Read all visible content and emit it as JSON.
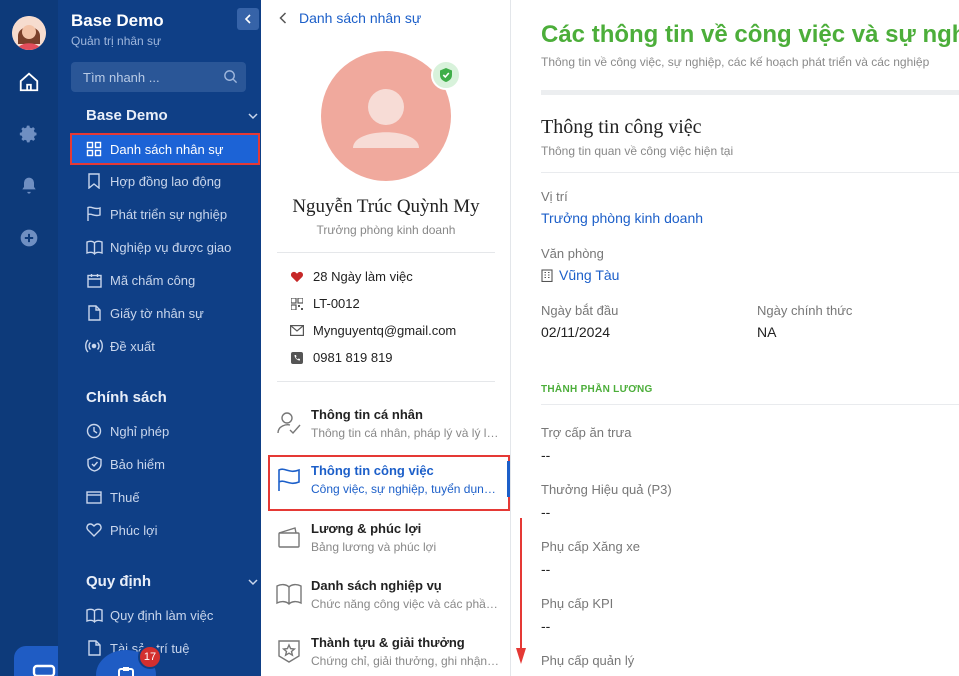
{
  "app": {
    "title": "Base Demo",
    "subtitle": "Quản trị nhân sự",
    "search_placeholder": "Tìm nhanh ...",
    "badge_count": "17"
  },
  "rail": {
    "icons": [
      "home-icon",
      "gear-icon",
      "bell-icon",
      "plus-circle-icon"
    ]
  },
  "sidebar": {
    "sections": [
      {
        "title": "Base Demo",
        "items": [
          {
            "label": "Danh sách nhân sự",
            "icon": "grid-icon",
            "active": true
          },
          {
            "label": "Hợp đồng lao động",
            "icon": "bookmark-icon"
          },
          {
            "label": "Phát triển sự nghiệp",
            "icon": "flag-icon"
          },
          {
            "label": "Nghiệp vụ được giao",
            "icon": "book-icon"
          },
          {
            "label": "Mã chấm công",
            "icon": "calendar-icon"
          },
          {
            "label": "Giấy tờ nhân sự",
            "icon": "document-icon"
          },
          {
            "label": "Đề xuất",
            "icon": "broadcast-icon"
          }
        ]
      },
      {
        "title": "Chính sách",
        "items": [
          {
            "label": "Nghỉ phép",
            "icon": "clock-icon"
          },
          {
            "label": "Bảo hiểm",
            "icon": "shield-icon"
          },
          {
            "label": "Thuế",
            "icon": "card-icon"
          },
          {
            "label": "Phúc lợi",
            "icon": "heart-icon"
          }
        ]
      },
      {
        "title": "Quy định",
        "items": [
          {
            "label": "Quy định làm việc",
            "icon": "book-icon"
          },
          {
            "label": "Tài sản trí tuệ",
            "icon": "document-icon"
          }
        ]
      }
    ]
  },
  "profile": {
    "back_label": "Danh sách nhân sự",
    "name": "Nguyễn Trúc Quỳnh My",
    "role": "Trưởng phòng kinh doanh",
    "details": [
      {
        "icon": "heart-icon",
        "text": "28 Ngày làm việc"
      },
      {
        "icon": "qr-icon",
        "text": "LT-0012"
      },
      {
        "icon": "mail-icon",
        "text": "Mynguyentq@gmail.com"
      },
      {
        "icon": "phone-icon",
        "text": "0981 819 819"
      }
    ],
    "menu": [
      {
        "title": "Thông tin cá nhân",
        "desc": "Thông tin cá nhân, pháp lý và lý lịch",
        "icon": "user-check-icon"
      },
      {
        "title": "Thông tin công việc",
        "desc": "Công việc, sự nghiệp, tuyển dụng ...",
        "icon": "flag-icon",
        "active": true
      },
      {
        "title": "Lương & phúc lợi",
        "desc": "Bảng lương và phúc lợi",
        "icon": "wallet-icon"
      },
      {
        "title": "Danh sách nghiệp vụ",
        "desc": "Chức năng công việc và các phần...",
        "icon": "book-icon"
      },
      {
        "title": "Thành tựu & giải thưởng",
        "desc": "Chứng chỉ, giải thưởng, ghi nhận v...",
        "icon": "star-badge-icon"
      }
    ]
  },
  "main": {
    "title": "Các thông tin về công việc và sự nghiệp",
    "subtitle": "Thông tin về công việc, sự nghiệp, các kế hoạch phát triển và các nghiệp",
    "section_title": "Thông tin công việc",
    "section_subtitle": "Thông tin quan về công việc hiện tại",
    "fields": {
      "position_label": "Vị trí",
      "position_value": "Trưởng phòng kinh doanh",
      "office_label": "Văn phòng",
      "office_value": "Vũng Tàu",
      "start_label": "Ngày bắt đầu",
      "start_value": "02/11/2024",
      "official_label": "Ngày chính thức",
      "official_value": "NA"
    },
    "salary_header": "THÀNH PHẦN LƯƠNG",
    "salary_items": [
      {
        "label": "Trợ cấp ăn trưa",
        "value": "--"
      },
      {
        "label": "Thưởng Hiệu quả (P3)",
        "value": "--"
      },
      {
        "label": "Phụ cấp Xăng xe",
        "value": "--"
      },
      {
        "label": "Phụ cấp KPI",
        "value": "--"
      },
      {
        "label": "Phụ cấp quản lý",
        "value": ""
      }
    ]
  },
  "colors": {
    "rail": "#0d3a7a",
    "sidebar": "#0f3f86",
    "active_nav": "#1c63d6",
    "accent_green": "#4cae3a",
    "link_blue": "#1c5fc9",
    "highlight_red": "#e53935"
  }
}
